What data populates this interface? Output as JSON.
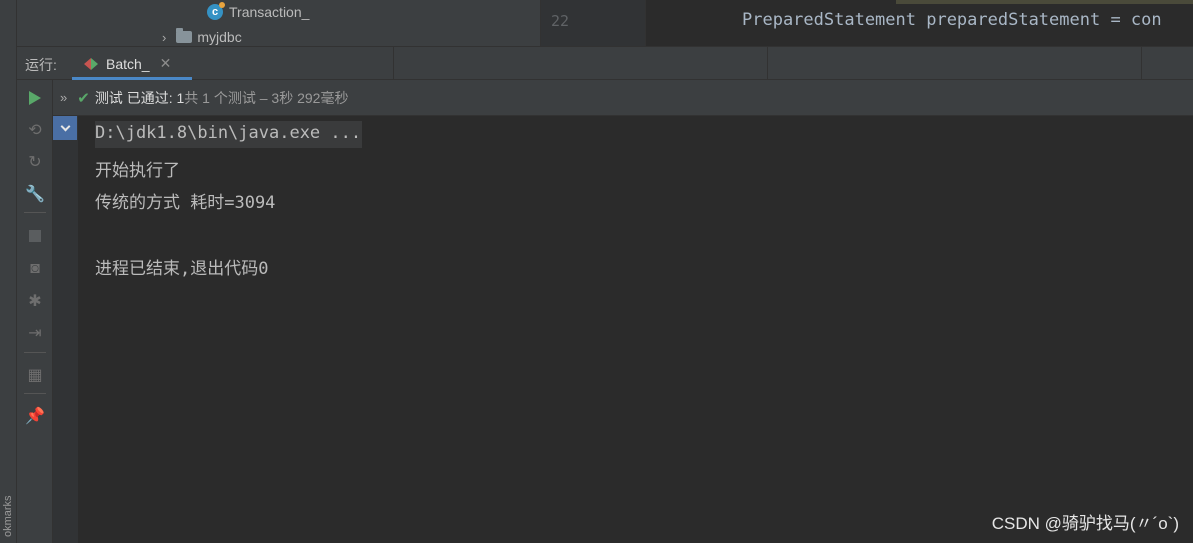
{
  "bookmarks": {
    "label": "okmarks"
  },
  "project_tree": {
    "items": [
      {
        "label": "Transaction_",
        "icon": "class-icon"
      },
      {
        "label": "myjdbc",
        "icon": "folder-icon"
      }
    ]
  },
  "editor": {
    "line_number": "22",
    "code": "PreparedStatement preparedStatement = con"
  },
  "run_panel": {
    "run_label": "运行:",
    "tab_label": "Batch_",
    "tab_close": "✕"
  },
  "status": {
    "expand": "»",
    "passed_text": "测试 已通过: 1",
    "detail_text": "共 1 个测试 – 3秒 292毫秒"
  },
  "console": {
    "lines": [
      "D:\\jdk1.8\\bin\\java.exe ...",
      "开始执行了",
      "传统的方式 耗时=3094",
      "",
      "进程已结束,退出代码0"
    ]
  },
  "watermark": "CSDN @骑驴找马(〃´o`)",
  "colors": {
    "background": "#2b2b2b",
    "panel": "#3c3f41",
    "accent": "#4a88c7",
    "success": "#59a869"
  }
}
